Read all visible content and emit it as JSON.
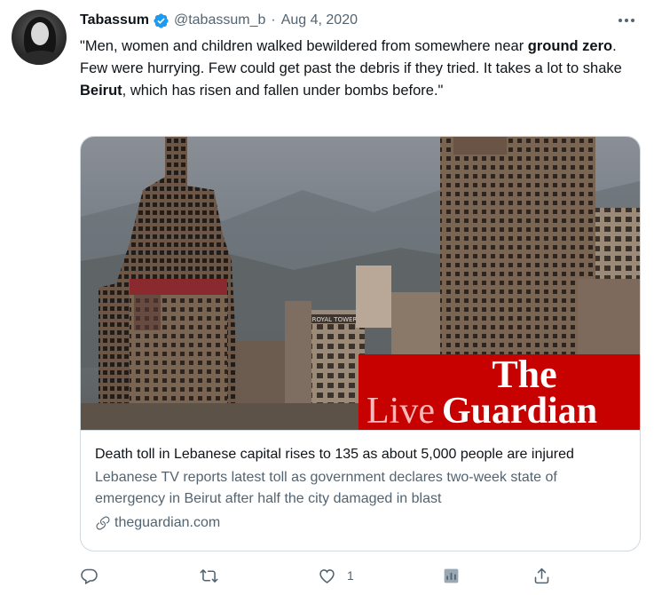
{
  "tweet": {
    "author_name": "Tabassum",
    "handle": "@tabassum_b",
    "separator": "·",
    "date": "Aug 4, 2020",
    "text_parts": [
      "\"Men, women and children walked bewildered from somewhere near ",
      "ground zero",
      ". Few were hurrying. Few could get past the debris if they tried. It takes a lot to shake ",
      "Beirut",
      ", which has risen and fallen under bombs before.\""
    ]
  },
  "card": {
    "logo_line1": "The",
    "logo_live": "Live",
    "logo_guardian": "Guardian",
    "sign_text": "ROYAL TOWER",
    "title": "Death toll in Lebanese capital rises to 135 as about 5,000 people are injured",
    "description": "Lebanese TV reports latest toll as government declares two-week state of emergency in Beirut after half the city damaged in blast",
    "domain": "theguardian.com"
  },
  "actions": {
    "reply_count": "",
    "retweet_count": "",
    "like_count": "1",
    "analytics_count": "",
    "share_count": ""
  },
  "icons": [
    "verified-icon",
    "more-icon",
    "link-icon",
    "reply-icon",
    "retweet-icon",
    "like-icon",
    "analytics-icon",
    "share-icon"
  ],
  "colors": {
    "verified": "#1d9bf0",
    "text": "#0f1419",
    "secondary": "#536471",
    "guardian_red": "#c70000",
    "border": "#cfd9de"
  }
}
